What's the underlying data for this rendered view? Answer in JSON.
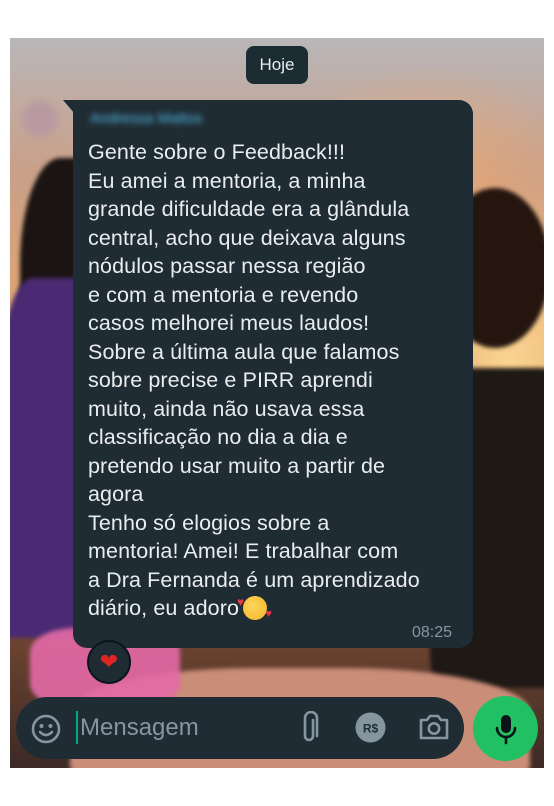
{
  "date_chip": "Hoje",
  "message": {
    "sender": "Andressa Mattos",
    "text": "Gente sobre o Feedback!!!\nEu amei a mentoria, a minha\ngrande dificuldade era a glândula\ncentral, acho que deixava alguns\nnódulos passar nessa região\ne com a mentoria e revendo\ncasos melhorei meus laudos!\nSobre a última aula que falamos\nsobre precise e PIRR aprendi\nmuito, ainda não usava essa\nclassificação no dia a dia e\npretendo usar muito a partir de\nagora\nTenho só elogios sobre a\nmentoria! Amei! E trabalhar com\na Dra Fernanda é um aprendizado\ndiário, eu adoro",
    "time": "08:25",
    "reaction": "❤"
  },
  "input": {
    "placeholder": "Mensagem"
  },
  "icons": {
    "emoji": "emoji-icon",
    "attach": "paperclip-icon",
    "payment": "payment-icon",
    "camera": "camera-icon",
    "mic": "microphone-icon"
  },
  "colors": {
    "bubble": "#1f2c33",
    "mic_button": "#21c063",
    "sender": "#53bdeb"
  }
}
